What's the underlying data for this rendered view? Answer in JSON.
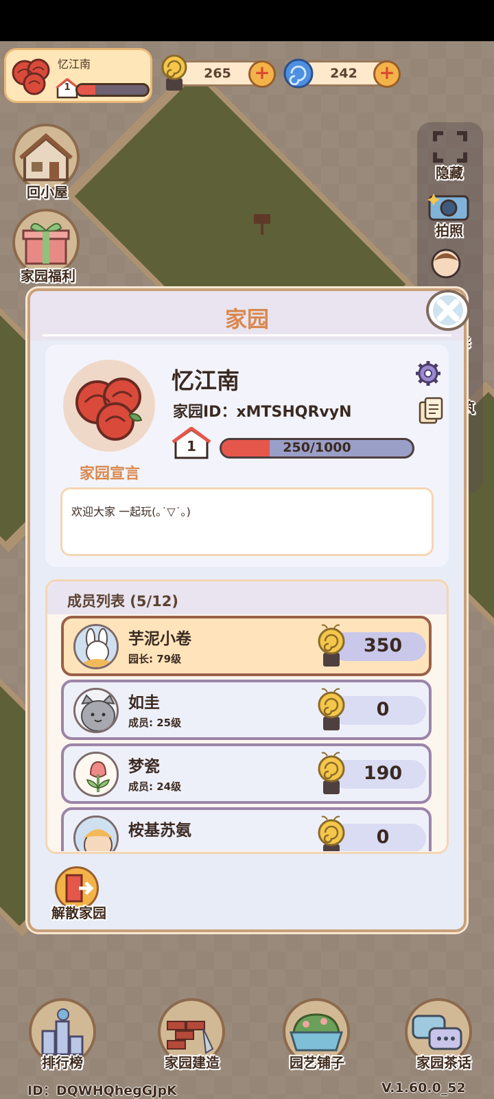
{
  "hud": {
    "player_name": "忆江南",
    "level": "1",
    "level_progress": 0.25,
    "snail_currency": "265",
    "swirl_currency": "242",
    "plus_label": "+"
  },
  "left_buttons": [
    {
      "label": "回小屋",
      "icon": "house-icon"
    },
    {
      "label": "家园福利",
      "icon": "gift-box-icon"
    }
  ],
  "right_buttons": [
    {
      "label": "隐藏",
      "icon": "frame-corners-icon"
    },
    {
      "label": "拍照",
      "icon": "camera-icon"
    },
    {
      "label": "修",
      "icon": "character-icon"
    },
    {
      "label": "筑",
      "icon": "build-icon"
    }
  ],
  "modal": {
    "title": "家园",
    "home_name": "忆江南",
    "home_id": "家园ID：xMTSHQRvyN",
    "level": "1",
    "exp_text": "250/1000",
    "exp_progress": 0.25,
    "declaration_label": "家园宣言",
    "declaration_text": "欢迎大家 一起玩(｡˙▽˙｡)",
    "members_title": "成员列表 (5/12)",
    "members": [
      {
        "name": "芋泥小卷",
        "role": "园长: 79级",
        "score": "350",
        "avatar": "bunny-avatar",
        "leader": true
      },
      {
        "name": "如圭",
        "role": "成员: 25级",
        "score": "0",
        "avatar": "cat-avatar",
        "leader": false
      },
      {
        "name": "梦瓷",
        "role": "成员: 24级",
        "score": "190",
        "avatar": "tulip-avatar",
        "leader": false
      },
      {
        "name": "桉基苏氨",
        "role": "",
        "score": "0",
        "avatar": "character-avatar",
        "leader": false
      }
    ],
    "disband_label": "解散家园"
  },
  "bottom_nav": [
    {
      "label": "排行榜",
      "icon": "leaderboard-icon"
    },
    {
      "label": "家园建造",
      "icon": "brick-trowel-icon"
    },
    {
      "label": "园艺铺子",
      "icon": "flower-pot-icon"
    },
    {
      "label": "家园茶话",
      "icon": "chat-bubbles-icon"
    }
  ],
  "footer": {
    "player_id": "ID：DQWHQhegGJpK",
    "version": "V.1.60.0_52"
  },
  "colors": {
    "accent_orange": "#d9884f",
    "progress_red": "#e5574a",
    "frame_brown": "#c9a07a",
    "panel_bg": "#e8ecf6"
  }
}
